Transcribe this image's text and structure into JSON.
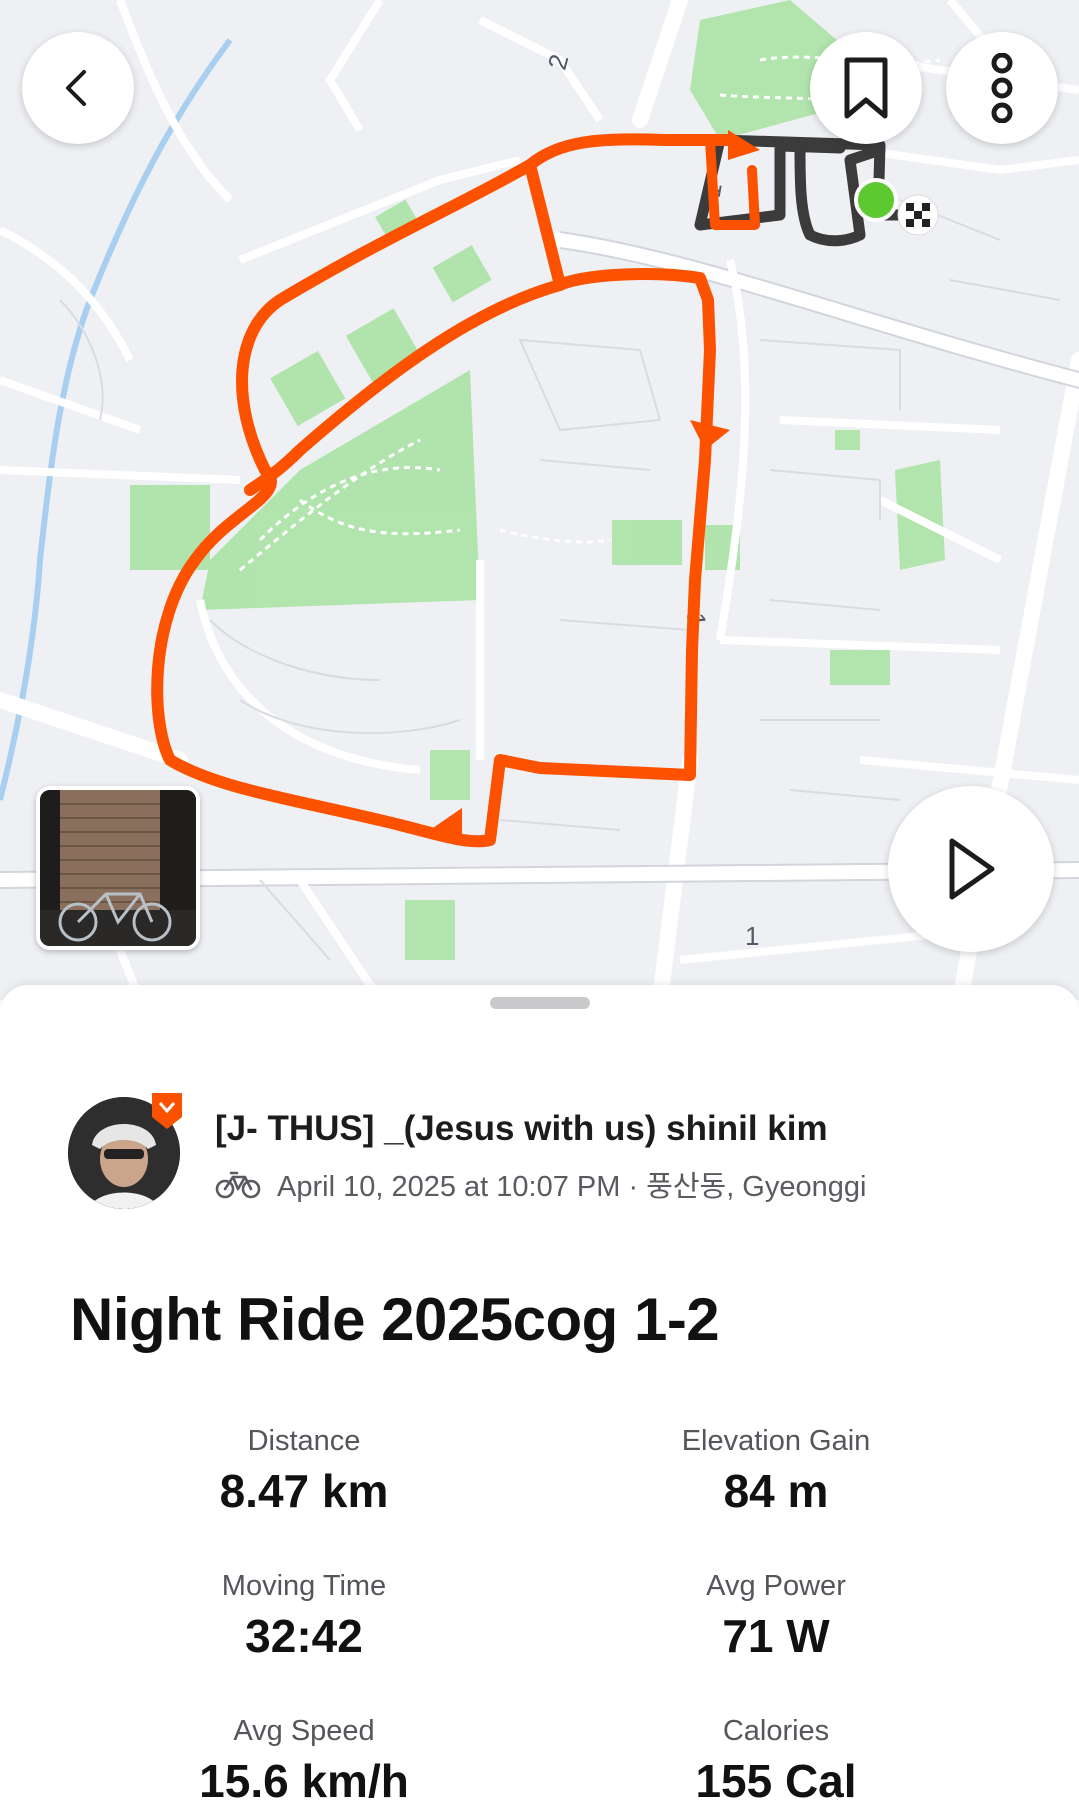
{
  "map": {
    "road_labels": [
      "2",
      "1",
      "1",
      "1"
    ],
    "route_color": "#fc5200",
    "start_color": "#5dc930"
  },
  "header": {
    "back_icon": "chevron-left-icon",
    "bookmark_icon": "bookmark-icon",
    "more_icon": "more-vertical-icon"
  },
  "play_icon": "play-icon",
  "activity": {
    "athlete_name": "[J- THUS] _(Jesus with us) shinil kim",
    "sport_icon": "bike-icon",
    "date_location": "April 10, 2025 at 10:07 PM · 풍산동, Gyeonggi",
    "title": "Night Ride 2025cog 1-2"
  },
  "stats": [
    {
      "label": "Distance",
      "value": "8.47 km"
    },
    {
      "label": "Elevation Gain",
      "value": "84 m"
    },
    {
      "label": "Moving Time",
      "value": "32:42"
    },
    {
      "label": "Avg Power",
      "value": "71 W"
    },
    {
      "label": "Avg Speed",
      "value": "15.6 km/h"
    },
    {
      "label": "Calories",
      "value": "155 Cal"
    }
  ]
}
